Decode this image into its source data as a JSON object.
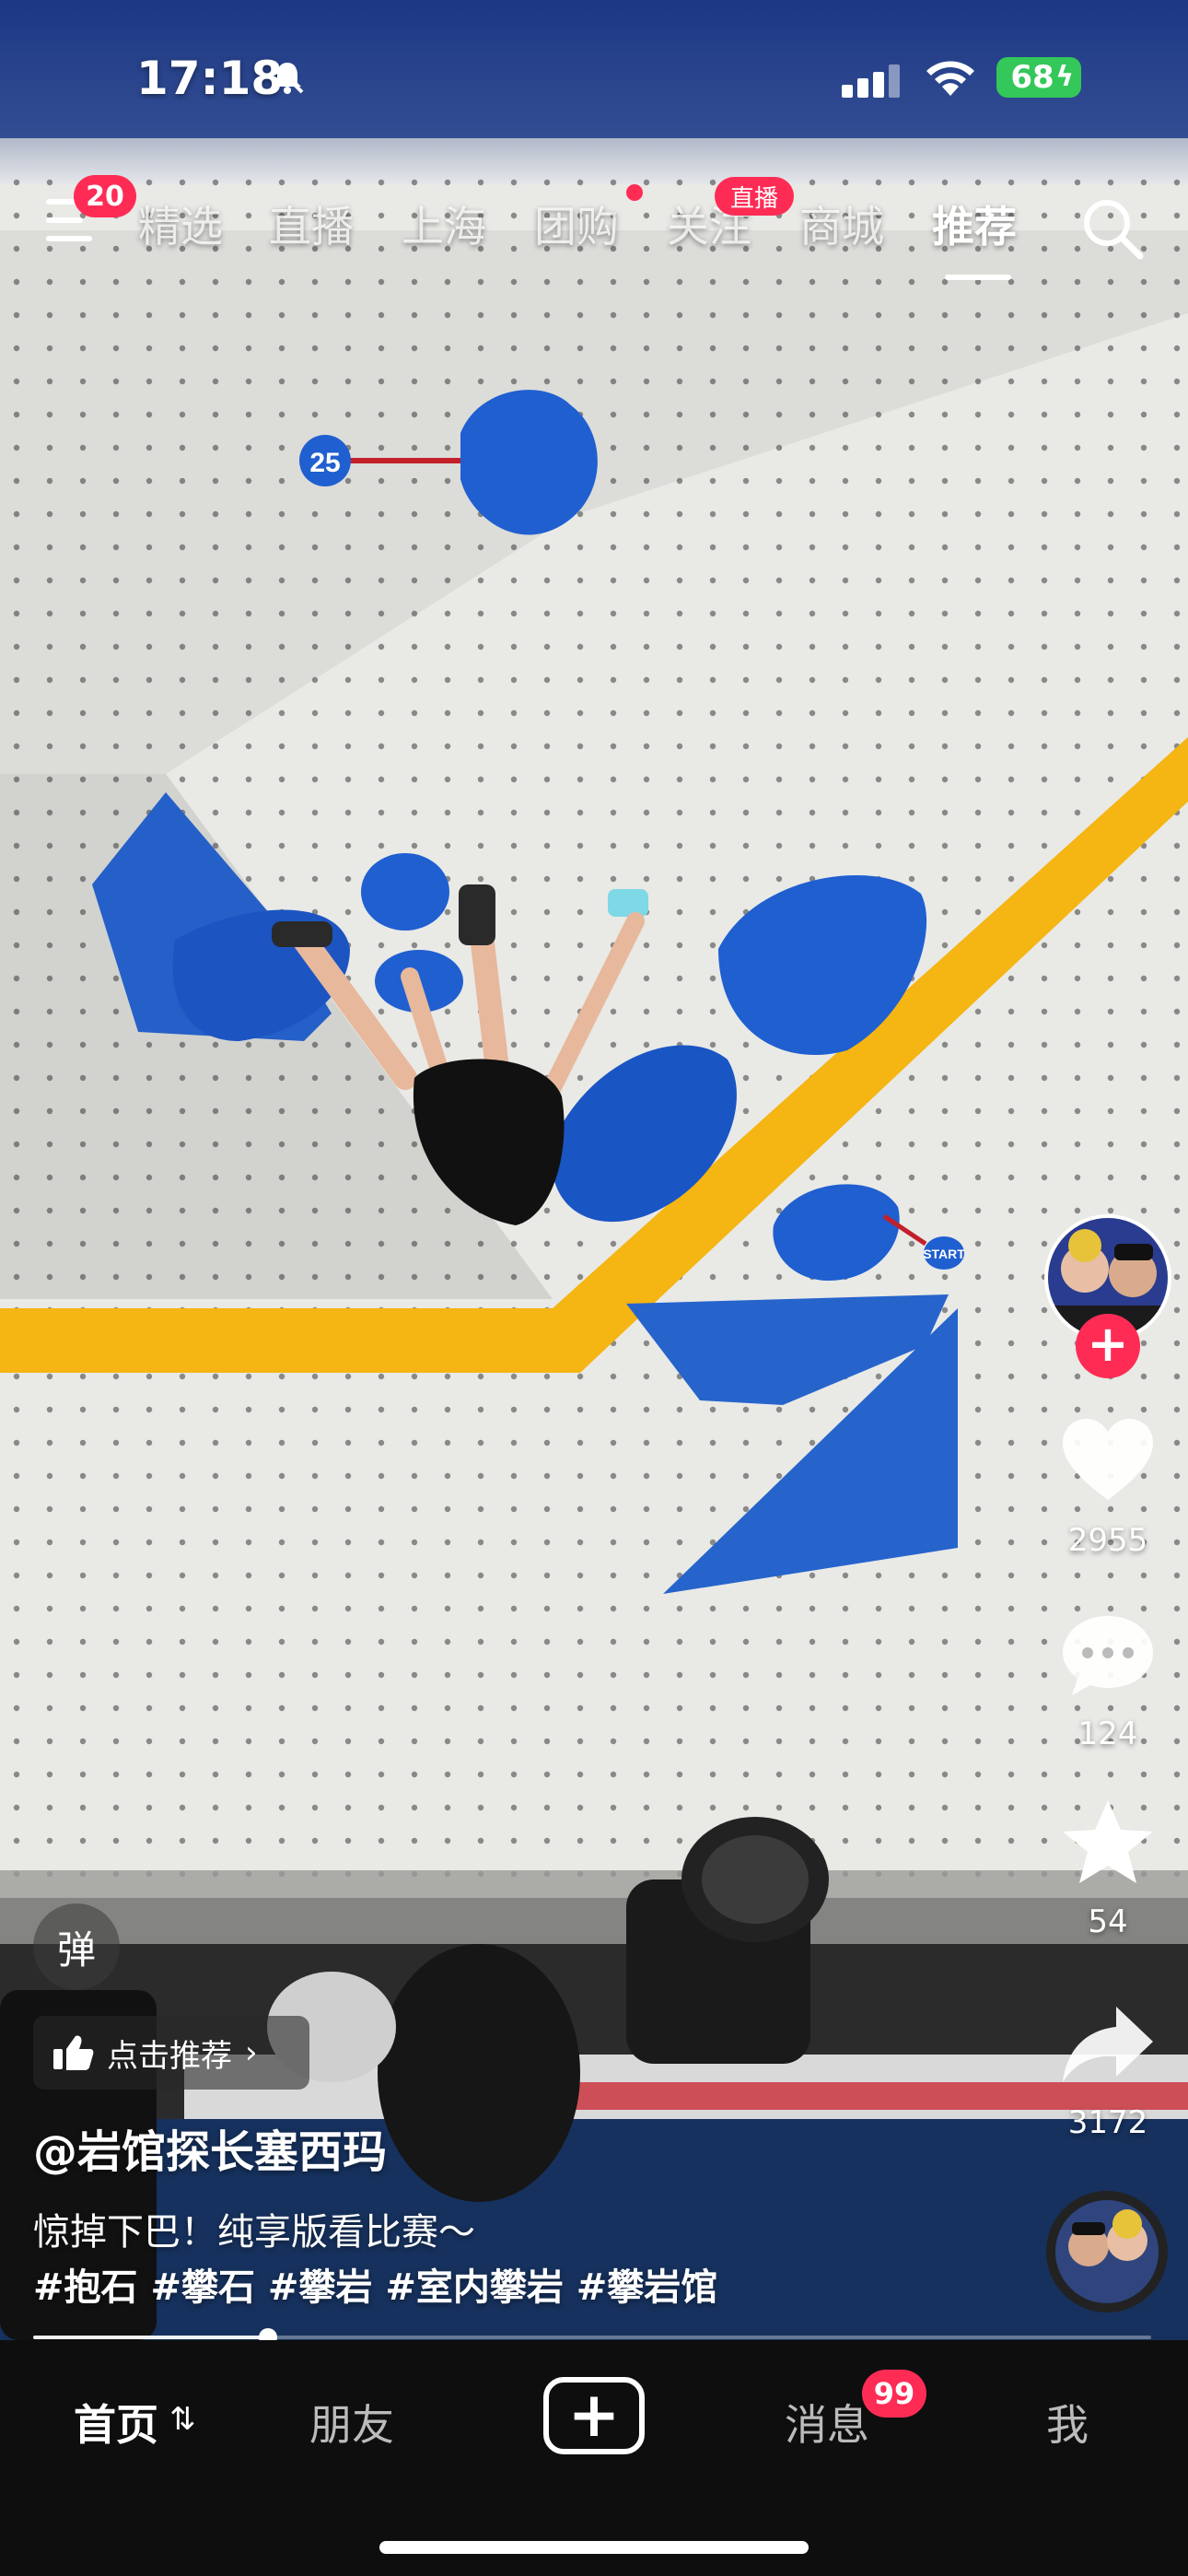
{
  "status_bar": {
    "time": "17:18",
    "battery": "68"
  },
  "top_nav": {
    "menu_badge": "20",
    "tabs": [
      {
        "label": "精选"
      },
      {
        "label": "直播"
      },
      {
        "label": "上海"
      },
      {
        "label": "团购"
      },
      {
        "label": "关注"
      },
      {
        "label": "商城"
      },
      {
        "label": "推荐"
      }
    ],
    "active_tab": "推荐",
    "live_badge": "直播"
  },
  "video": {
    "hold_number": "25",
    "start_tag": "START"
  },
  "rail": {
    "likes": "2955",
    "comments": "124",
    "favorites": "54",
    "shares": "3172"
  },
  "overlay": {
    "danmu_label": "弹",
    "recommend_chip": "点击推荐",
    "author": "@岩馆探长塞西玛",
    "caption": "惊掉下巴！纯享版看比赛～",
    "hashtags": "#抱石 #攀石 #攀岩 #室内攀岩 #攀岩馆",
    "progress": 0.21
  },
  "bottom_nav": {
    "home": "首页",
    "friends": "朋友",
    "messages": "消息",
    "messages_badge": "99",
    "me": "我"
  },
  "colors": {
    "accent": "#fe2c55",
    "battery": "#34c759",
    "wall": "#e9e9e6",
    "hold_blue": "#1f5fd0",
    "tape_yellow": "#f5b512"
  }
}
